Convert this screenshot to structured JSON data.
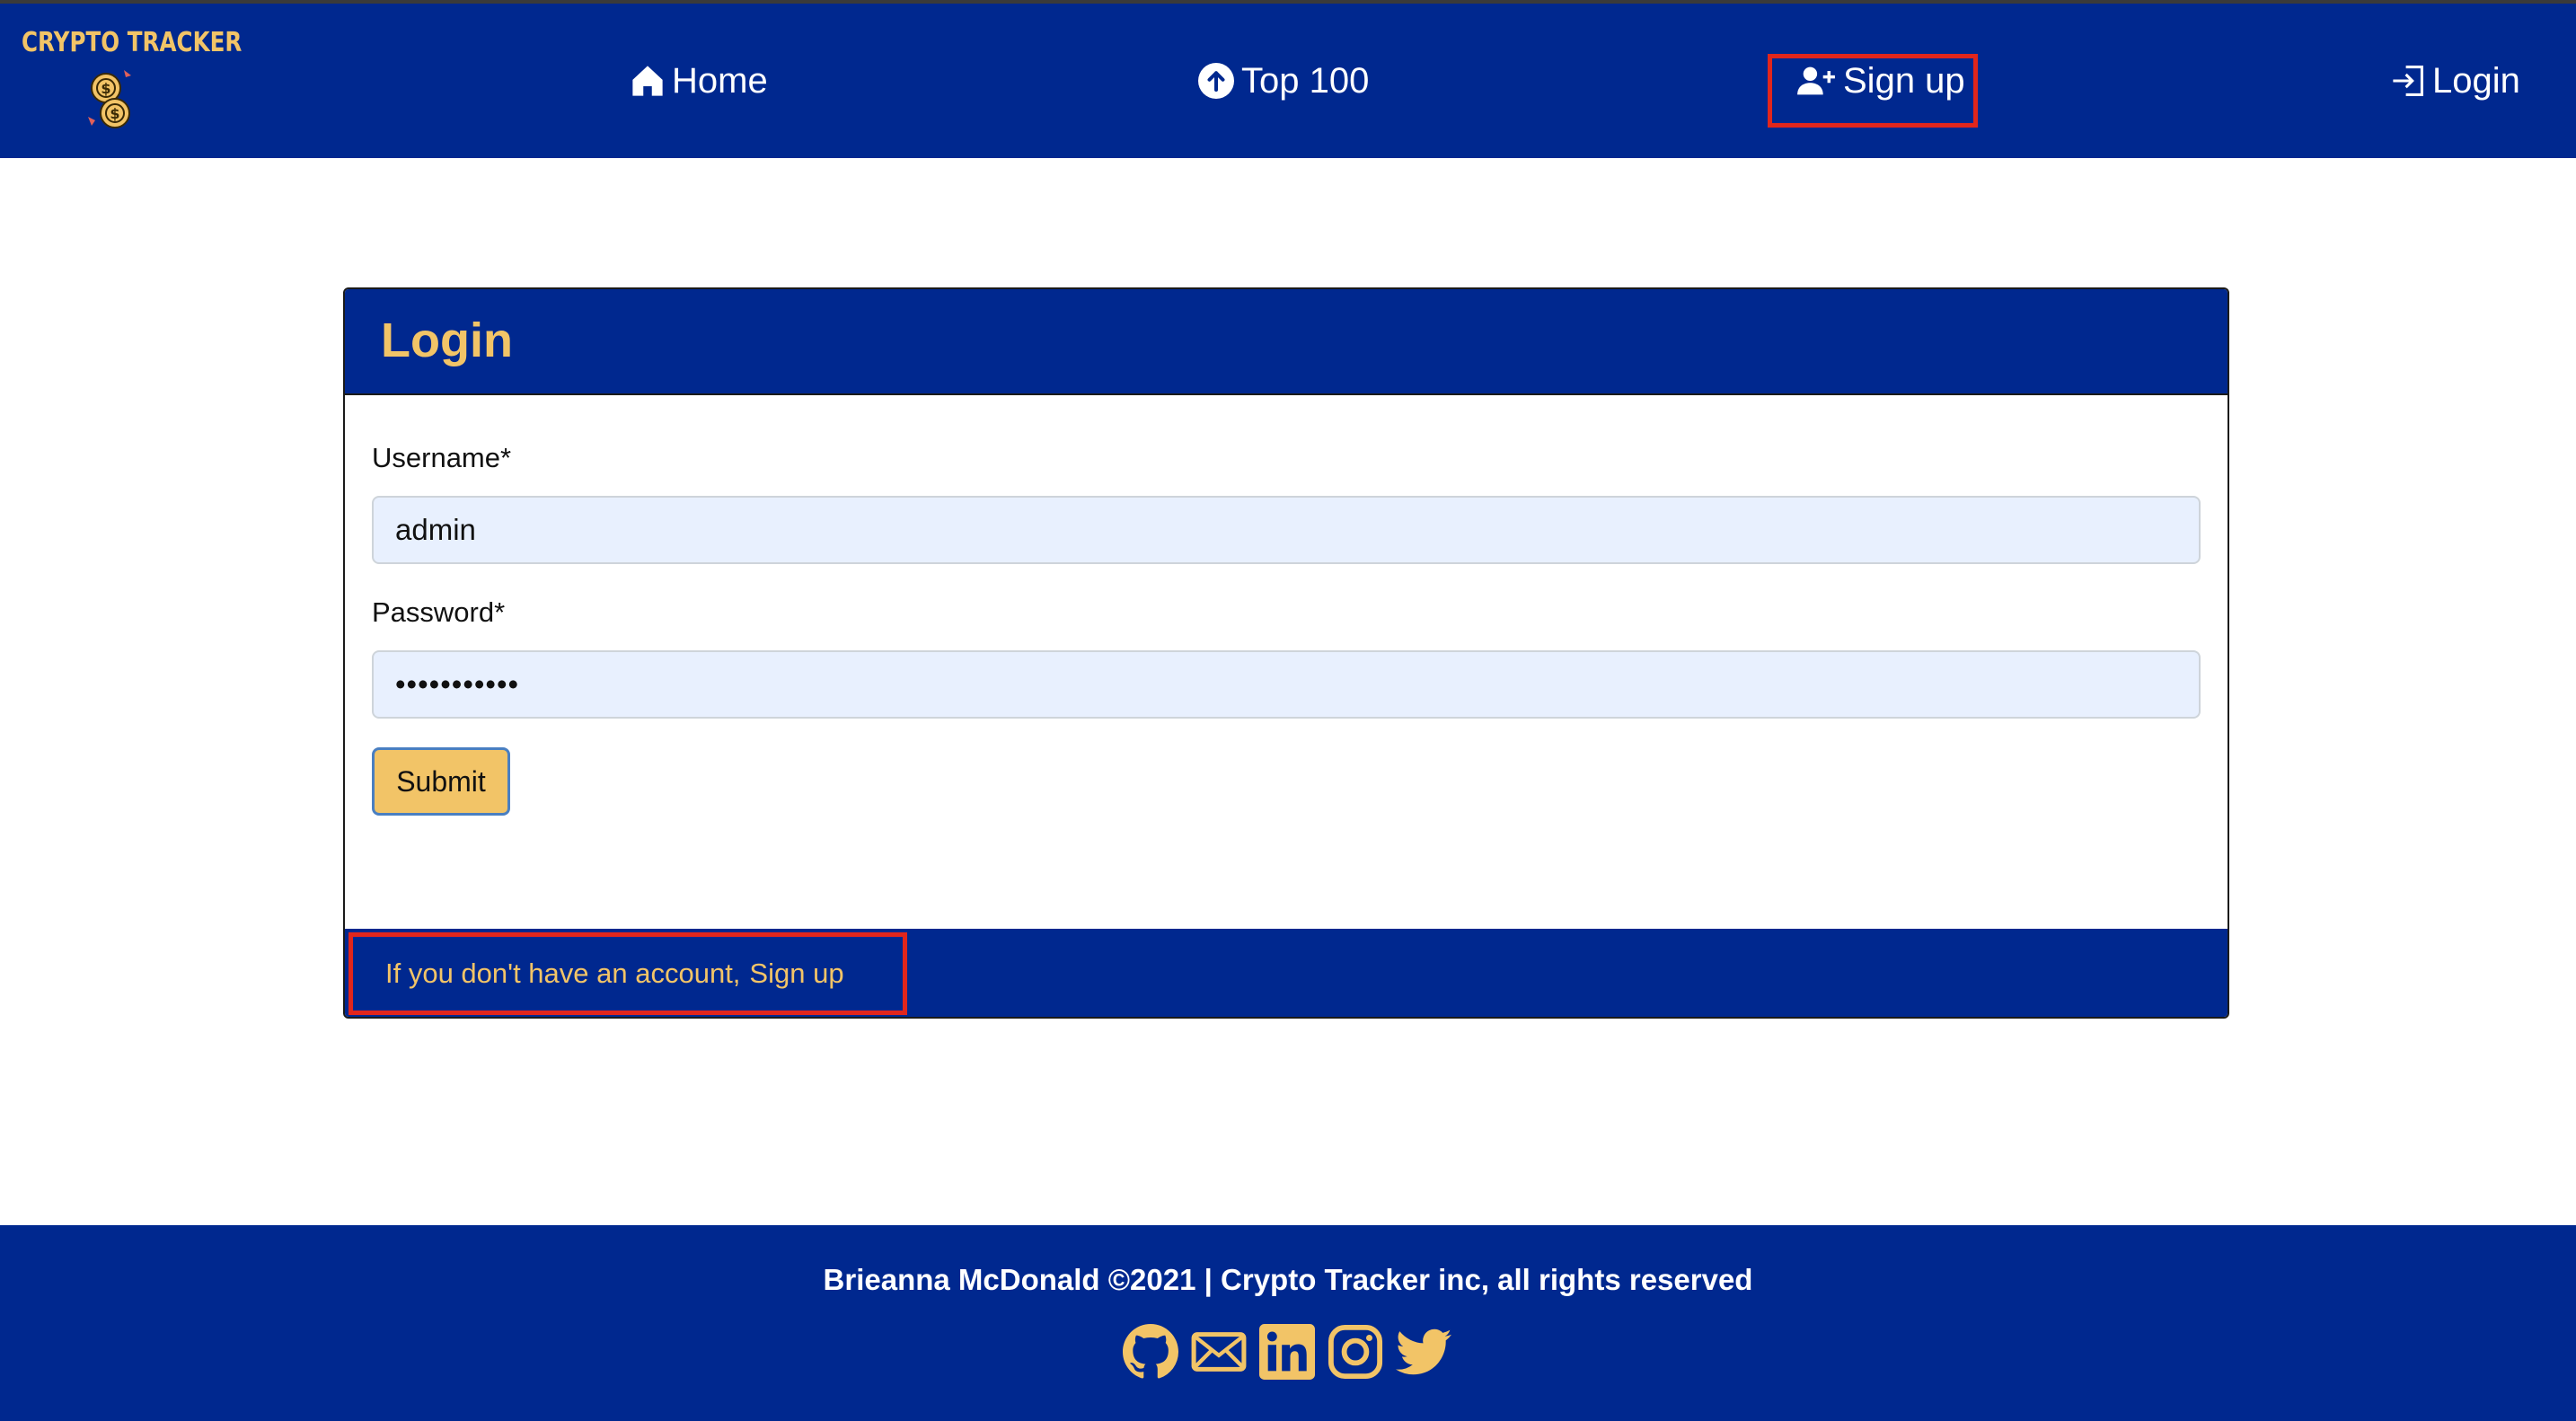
{
  "navbar": {
    "logo_text": "CRYPTO TRACKER",
    "items": [
      {
        "label": "Home",
        "icon": "home-icon"
      },
      {
        "label": "Top 100",
        "icon": "arrow-up-circle-icon"
      },
      {
        "label": "Sign up",
        "icon": "person-plus-icon"
      },
      {
        "label": "Login",
        "icon": "box-arrow-in-right-icon"
      }
    ]
  },
  "login_card": {
    "title": "Login",
    "username_label": "Username*",
    "username_value": "admin",
    "password_label": "Password*",
    "password_value": "•••••••••••",
    "submit_label": "Submit",
    "footer_text": "If you don't have an account,",
    "footer_link": "Sign up"
  },
  "site_footer": {
    "copyright": "Brieanna McDonald ©2021 | Crypto Tracker inc, all rights reserved",
    "social_icons": [
      "github-icon",
      "envelope-icon",
      "linkedin-icon",
      "instagram-icon",
      "twitter-icon"
    ]
  },
  "colors": {
    "brand_blue": "#00288f",
    "accent_gold": "#f2c467",
    "highlight_red": "#e1261c",
    "input_bg": "#e8f0fe"
  }
}
